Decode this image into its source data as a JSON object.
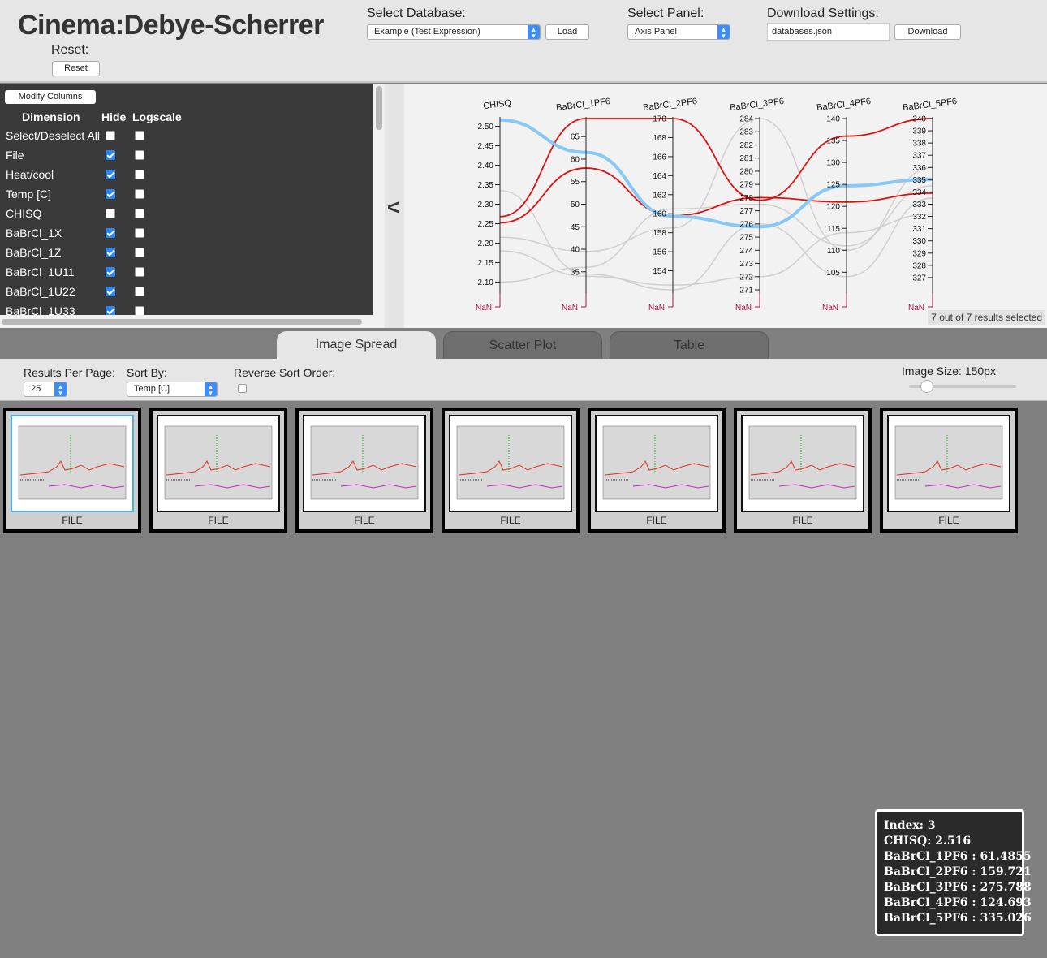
{
  "header": {
    "title": "Cinema:Debye-Scherrer",
    "reset_label": "Reset:",
    "reset_button": "Reset",
    "select_database_label": "Select Database:",
    "database_selected": "Example (Test Expression)",
    "load_button": "Load",
    "select_panel_label": "Select Panel:",
    "panel_selected": "Axis Panel",
    "download_settings_label": "Download Settings:",
    "download_filename": "databases.json",
    "download_button": "Download"
  },
  "dimensions_panel": {
    "modify_columns_button": "Modify Columns",
    "header_dimension": "Dimension",
    "header_hide": "Hide",
    "header_logscale": "Logscale",
    "rows": [
      {
        "name": "Select/Deselect All",
        "hide": false,
        "logscale": false
      },
      {
        "name": "File",
        "hide": true,
        "logscale": false
      },
      {
        "name": "Heat/cool",
        "hide": true,
        "logscale": false
      },
      {
        "name": "Temp [C]",
        "hide": true,
        "logscale": false
      },
      {
        "name": "CHISQ",
        "hide": false,
        "logscale": false
      },
      {
        "name": "BaBrCl_1X",
        "hide": true,
        "logscale": false
      },
      {
        "name": "BaBrCl_1Z",
        "hide": true,
        "logscale": false
      },
      {
        "name": "BaBrCl_1U11",
        "hide": true,
        "logscale": false
      },
      {
        "name": "BaBrCl_1U22",
        "hide": true,
        "logscale": false
      },
      {
        "name": "BaBrCl_1U33",
        "hide": true,
        "logscale": false
      }
    ]
  },
  "collapse_glyph": "<",
  "parallel_coords": {
    "selected_text": "7 out of 7 results selected",
    "nan_label": "NaN",
    "colors": {
      "selected_highlight": "#88c8f4",
      "selected": "#e01010",
      "unselected": "#cfcfcf",
      "axis_nan": "#b0104a"
    },
    "axes": [
      {
        "name": "CHISQ",
        "min": 2.08,
        "max": 2.52,
        "ticks": [
          "2.50",
          "2.45",
          "2.40",
          "2.35",
          "2.30",
          "2.25",
          "2.20",
          "2.15",
          "2.10"
        ],
        "tick_values": [
          2.5,
          2.45,
          2.4,
          2.35,
          2.3,
          2.25,
          2.2,
          2.15,
          2.1
        ]
      },
      {
        "name": "BaBrCl_1PF6",
        "min": 31,
        "max": 69,
        "ticks": [
          "65",
          "60",
          "55",
          "50",
          "45",
          "40",
          "35"
        ],
        "tick_values": [
          65,
          60,
          55,
          50,
          45,
          40,
          35
        ]
      },
      {
        "name": "BaBrCl_2PF6",
        "min": 152,
        "max": 170,
        "ticks": [
          "170",
          "168",
          "166",
          "164",
          "162",
          "160",
          "158",
          "156",
          "154"
        ],
        "tick_values": [
          170,
          168,
          166,
          164,
          162,
          160,
          158,
          156,
          154
        ]
      },
      {
        "name": "BaBrCl_3PF6",
        "min": 271,
        "max": 284,
        "ticks": [
          "284",
          "283",
          "282",
          "281",
          "280",
          "279",
          "278",
          "277",
          "276",
          "275",
          "274",
          "273",
          "272",
          "271"
        ],
        "tick_values": [
          284,
          283,
          282,
          281,
          280,
          279,
          278,
          277,
          276,
          275,
          274,
          273,
          272,
          271
        ]
      },
      {
        "name": "BaBrCl_4PF6",
        "min": 101,
        "max": 140,
        "ticks": [
          "140",
          "135",
          "130",
          "125",
          "120",
          "115",
          "110",
          "105"
        ],
        "tick_values": [
          140,
          135,
          130,
          125,
          120,
          115,
          110,
          105
        ]
      },
      {
        "name": "BaBrCl_5PF6",
        "min": 326,
        "max": 340,
        "ticks": [
          "340",
          "339",
          "338",
          "337",
          "336",
          "335",
          "334",
          "333",
          "332",
          "331",
          "330",
          "329",
          "328",
          "327"
        ],
        "tick_values": [
          340,
          339,
          338,
          337,
          336,
          335,
          334,
          333,
          332,
          331,
          330,
          329,
          328,
          327
        ]
      }
    ],
    "lines": [
      {
        "state": "highlight",
        "values": [
          2.516,
          61.4855,
          159.721,
          275.788,
          124.693,
          335.026
        ]
      },
      {
        "state": "selected",
        "values": [
          2.268,
          69,
          170,
          277.8,
          136,
          340
        ]
      },
      {
        "state": "selected",
        "values": [
          2.252,
          58,
          159.8,
          278.0,
          121,
          333.9
        ]
      },
      {
        "state": "unselected",
        "values": [
          2.335,
          34.5,
          152,
          276.0,
          104,
          333.5
        ]
      },
      {
        "state": "unselected",
        "values": [
          2.215,
          39.5,
          158.5,
          284.0,
          110,
          336.0
        ]
      },
      {
        "state": "unselected",
        "values": [
          2.1,
          36.0,
          160.5,
          277.5,
          111,
          334.5
        ]
      },
      {
        "state": "unselected",
        "values": [
          2.18,
          34.0,
          152.5,
          272.0,
          114,
          332.2
        ]
      }
    ]
  },
  "tabs": [
    {
      "label": "Image Spread",
      "active": true
    },
    {
      "label": "Scatter Plot",
      "active": false
    },
    {
      "label": "Table",
      "active": false
    }
  ],
  "controls": {
    "results_per_page_label": "Results Per Page:",
    "results_per_page_value": "25",
    "sort_by_label": "Sort By:",
    "sort_by_value": "Temp [C]",
    "reverse_sort_label": "Reverse Sort Order:",
    "image_size_label": "Image Size: 150px"
  },
  "results": [
    {
      "label": "FILE",
      "selected": true
    },
    {
      "label": "FILE",
      "selected": false
    },
    {
      "label": "FILE",
      "selected": false
    },
    {
      "label": "FILE",
      "selected": false
    },
    {
      "label": "FILE",
      "selected": false
    },
    {
      "label": "FILE",
      "selected": false
    },
    {
      "label": "FILE",
      "selected": false
    }
  ],
  "tooltip": {
    "lines": [
      "Index: 3",
      "CHISQ: 2.516",
      "BaBrCl_1PF6 : 61.4855",
      "BaBrCl_2PF6 : 159.721",
      "BaBrCl_3PF6 : 275.788",
      "BaBrCl_4PF6 : 124.693",
      "BaBrCl_5PF6 : 335.026"
    ]
  }
}
